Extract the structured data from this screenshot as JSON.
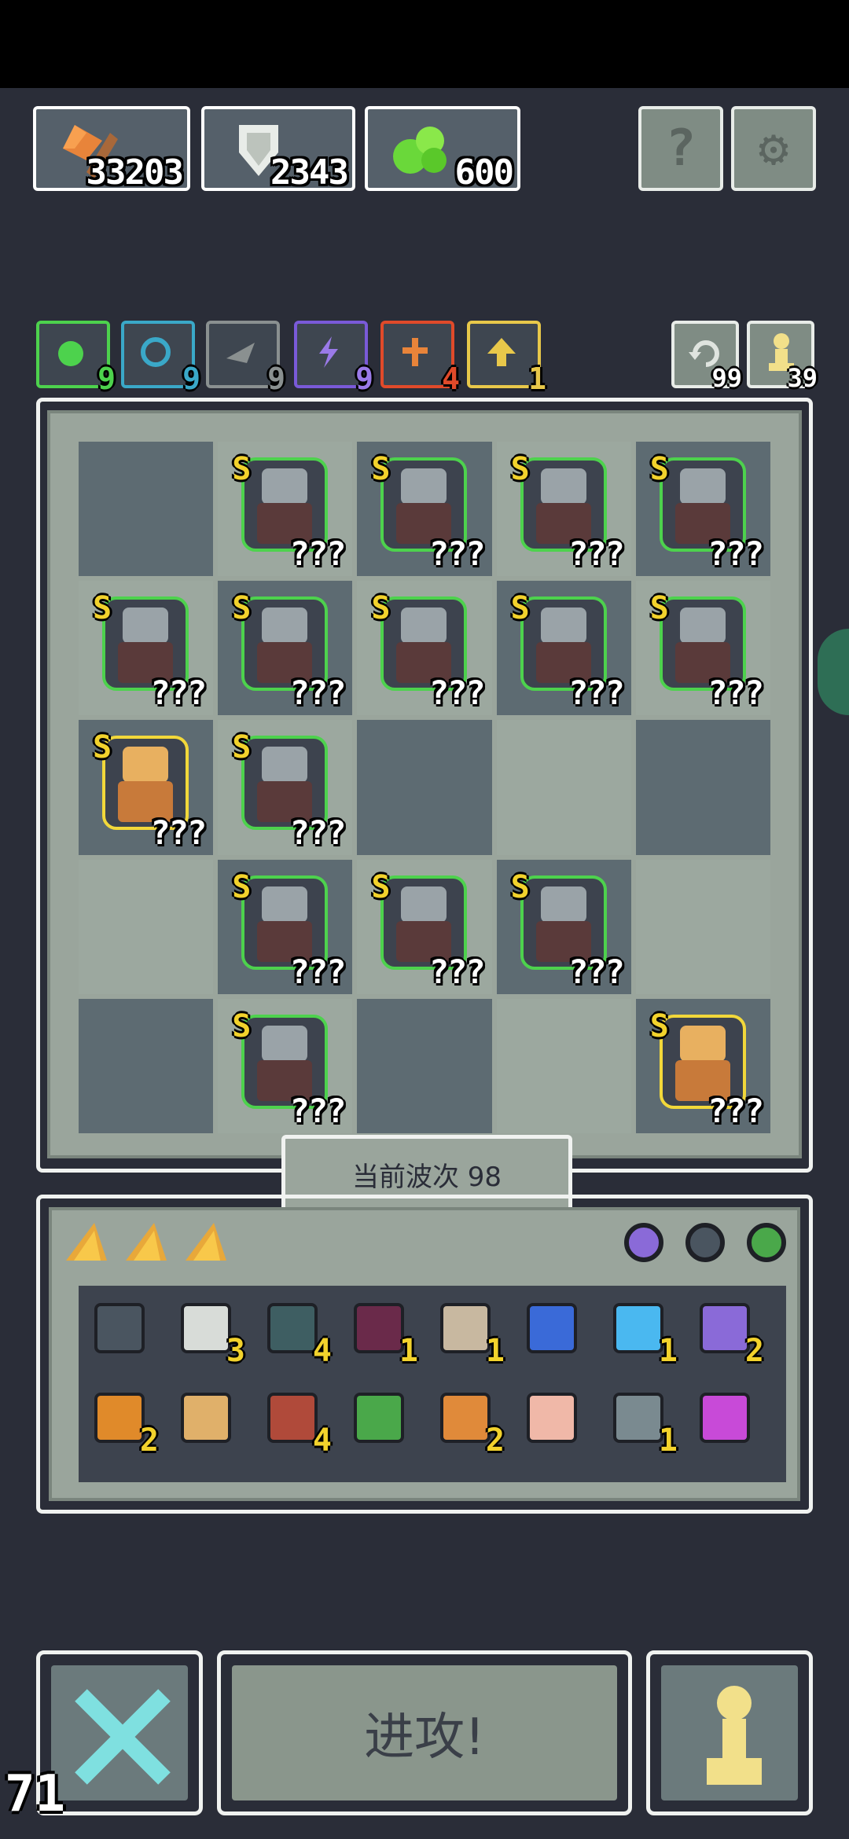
{
  "resources": [
    {
      "name": "axe-icon",
      "value": "33203",
      "border": "#e8c84a"
    },
    {
      "name": "shield-icon",
      "value": "2343",
      "border": "#d8dcd8"
    },
    {
      "name": "slime-icon",
      "value": "600",
      "border": "#e07a3a"
    }
  ],
  "top_buttons": {
    "help": "?",
    "settings": "⚙"
  },
  "synergies": [
    {
      "name": "nature-icon",
      "count": "9",
      "color": "#4dd24d"
    },
    {
      "name": "spiral-icon",
      "count": "9",
      "color": "#3aa8c8"
    },
    {
      "name": "wing-icon",
      "count": "9",
      "color": "#8a9090"
    },
    {
      "name": "lightning-icon",
      "count": "9",
      "color": "#7a5ad8"
    },
    {
      "name": "cross-icon",
      "count": "4",
      "color": "#e04a2a"
    },
    {
      "name": "up-arrow-icon",
      "count": "1",
      "color": "#e8c84a"
    }
  ],
  "side_buttons": [
    {
      "name": "refresh-icon",
      "count": "99"
    },
    {
      "name": "pawn-icon",
      "count": "39"
    }
  ],
  "board": {
    "rows": [
      [
        null,
        {
          "rank": "S",
          "lvl": "???",
          "tier": "green"
        },
        {
          "rank": "S",
          "lvl": "???",
          "tier": "green"
        },
        {
          "rank": "S",
          "lvl": "???",
          "tier": "green"
        },
        {
          "rank": "S",
          "lvl": "???",
          "tier": "green"
        }
      ],
      [
        {
          "rank": "S",
          "lvl": "???",
          "tier": "green"
        },
        {
          "rank": "S",
          "lvl": "???",
          "tier": "green"
        },
        {
          "rank": "S",
          "lvl": "???",
          "tier": "green"
        },
        {
          "rank": "S",
          "lvl": "???",
          "tier": "green"
        },
        {
          "rank": "S",
          "lvl": "???",
          "tier": "green"
        }
      ],
      [
        {
          "rank": "S",
          "lvl": "???",
          "tier": "gold"
        },
        {
          "rank": "S",
          "lvl": "???",
          "tier": "green"
        },
        null,
        null,
        null
      ],
      [
        null,
        {
          "rank": "S",
          "lvl": "???",
          "tier": "green"
        },
        {
          "rank": "S",
          "lvl": "???",
          "tier": "green"
        },
        {
          "rank": "S",
          "lvl": "???",
          "tier": "green"
        },
        null
      ],
      [
        null,
        {
          "rank": "S",
          "lvl": "???",
          "tier": "green"
        },
        null,
        null,
        {
          "rank": "S",
          "lvl": "???",
          "tier": "gold"
        }
      ]
    ],
    "wave_label": "当前波次 98"
  },
  "inventory": {
    "tabs": [
      "gold-bar-icon",
      "gold-bar-icon",
      "gold-bar-icon"
    ],
    "filters": [
      "purple-ring-icon",
      "dark-bug-icon",
      "green-ring-icon"
    ],
    "items": [
      {
        "name": "crate-icon",
        "count": "",
        "color": "#4a5560"
      },
      {
        "name": "scroll-skull-icon",
        "count": "3",
        "color": "#d8dcd8"
      },
      {
        "name": "heart-gem-icon",
        "count": "4",
        "color": "#3e5e62"
      },
      {
        "name": "demon-mask-icon",
        "count": "1",
        "color": "#6a2a4a"
      },
      {
        "name": "map-icon",
        "count": "1",
        "color": "#c8b8a0"
      },
      {
        "name": "blue-spirit-icon",
        "count": "",
        "color": "#3a6ad8"
      },
      {
        "name": "crystal-ball-icon",
        "count": "1",
        "color": "#4ab8f0"
      },
      {
        "name": "potion-icon",
        "count": "2",
        "color": "#8a6ad8"
      },
      {
        "name": "ring-icon",
        "count": "2",
        "color": "#e08a2a"
      },
      {
        "name": "antler-icon",
        "count": "",
        "color": "#e0b06a"
      },
      {
        "name": "hood-icon",
        "count": "4",
        "color": "#b04a3a"
      },
      {
        "name": "green-arrow-icon",
        "count": "",
        "color": "#4aa84a"
      },
      {
        "name": "orange-axe-icon",
        "count": "2",
        "color": "#e08a3a"
      },
      {
        "name": "eye-hand-icon",
        "count": "",
        "color": "#f0b8a8"
      },
      {
        "name": "robot-box-icon",
        "count": "1",
        "color": "#7a8a90"
      },
      {
        "name": "pink-arrow-icon",
        "count": "",
        "color": "#c84ad8"
      }
    ]
  },
  "controls": {
    "attack": "进攻!",
    "corner": "71"
  }
}
